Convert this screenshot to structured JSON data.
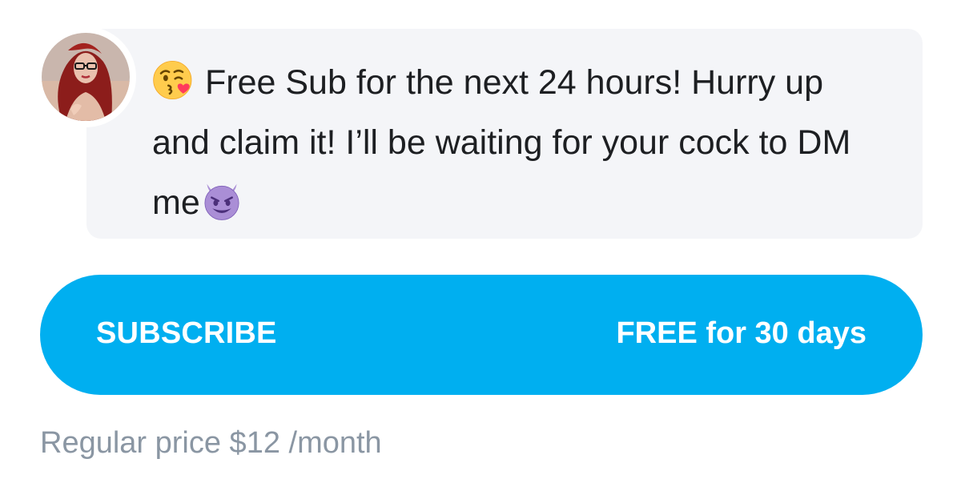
{
  "message": {
    "leading_emoji": "kissing-face-with-heart-icon",
    "text": "Free Sub for the next 24 hours! Hurry up and claim it! I’ll be waiting for your cock to DM me",
    "trailing_emoji": "smiling-devil-icon"
  },
  "subscribe": {
    "label": "SUBSCRIBE",
    "offer": "FREE for 30 days",
    "color": "#00aff0"
  },
  "regular_price": "Regular price $12 /month",
  "colors": {
    "bubble_bg": "#f4f5f8",
    "muted_text": "#8a96a3"
  }
}
